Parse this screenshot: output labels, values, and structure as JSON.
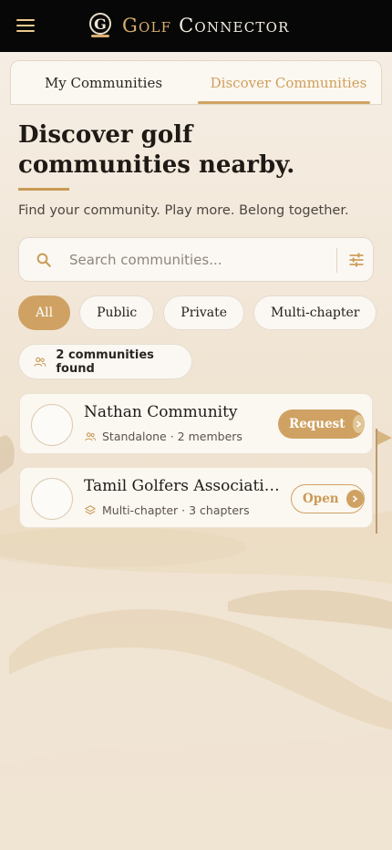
{
  "header": {
    "brand_golf": "Golf",
    "brand_connector": "Connector",
    "logo_letter": "G"
  },
  "tabs": [
    {
      "label": "My Communities",
      "active": false
    },
    {
      "label": "Discover Communities",
      "active": true
    }
  ],
  "hero": {
    "title": "Discover golf communities nearby.",
    "tagline": "Find your community. Play more. Belong together."
  },
  "search": {
    "placeholder": "Search communities...",
    "value": ""
  },
  "filters": [
    {
      "label": "All",
      "active": true
    },
    {
      "label": "Public",
      "active": false
    },
    {
      "label": "Private",
      "active": false
    },
    {
      "label": "Multi-chapter",
      "active": false
    }
  ],
  "results": {
    "count_label": "2 communities found"
  },
  "communities": [
    {
      "name": "Nathan Community",
      "meta": "Standalone · 2 members",
      "action": "Request",
      "meta_icon": "users-icon"
    },
    {
      "name": "Tamil Golfers Association C...",
      "meta": "Multi-chapter · 3 chapters",
      "action": "Open",
      "meta_icon": "layers-icon"
    }
  ],
  "colors": {
    "accent": "#cfa263",
    "topbar": "#070707",
    "background": "#f3ebe0"
  }
}
